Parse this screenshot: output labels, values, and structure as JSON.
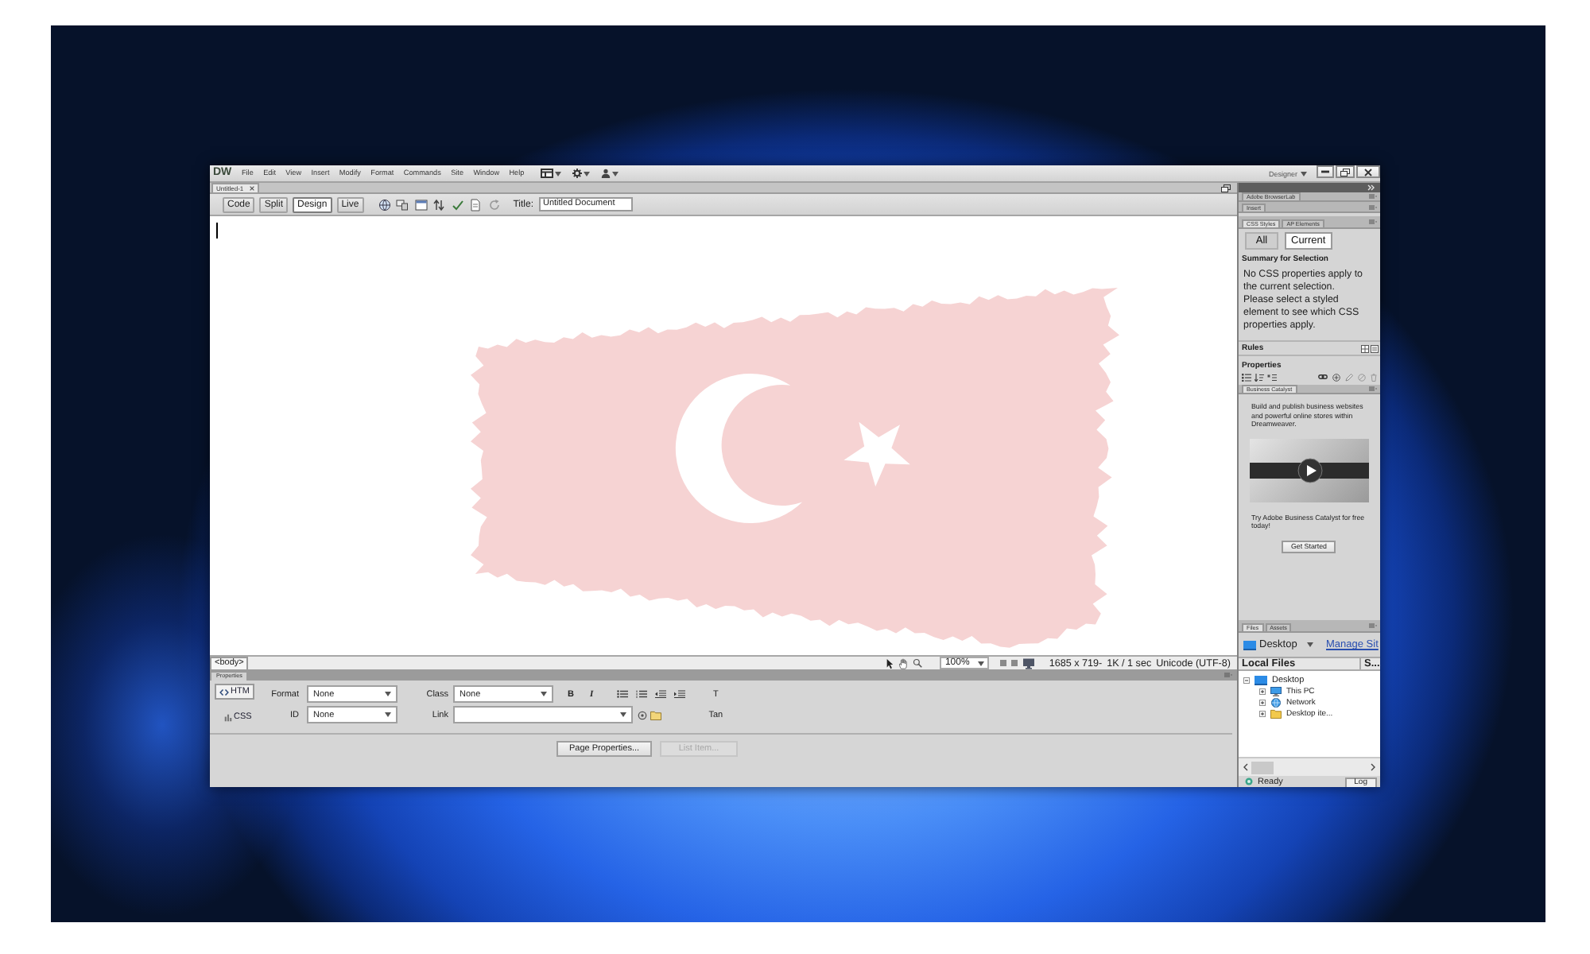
{
  "menu_bar": {
    "logo": "DW",
    "items": [
      "File",
      "Edit",
      "View",
      "Insert",
      "Modify",
      "Format",
      "Commands",
      "Site",
      "Window",
      "Help"
    ],
    "workspace": "Designer"
  },
  "document_tabs": [
    {
      "label": "Untitled-1",
      "selected": true
    }
  ],
  "toolbar": {
    "views": [
      {
        "label": "Code",
        "selected": false
      },
      {
        "label": "Split",
        "selected": false
      },
      {
        "label": "Design",
        "selected": true
      },
      {
        "label": "Live",
        "selected": false
      }
    ],
    "title_label": "Title:",
    "title_value": "Untitled Document"
  },
  "status_bar": {
    "tag": "<body>",
    "zoom": "100%",
    "size": "1685 x 719-",
    "download": "1K / 1 sec",
    "encoding": "Unicode (UTF-8)"
  },
  "properties": {
    "tab": "Properties",
    "modes": [
      {
        "label": "HTM",
        "kind": "html",
        "selected": true
      },
      {
        "label": "CSS",
        "kind": "css",
        "selected": false
      }
    ],
    "fields": [
      {
        "label": "Format",
        "value": "None"
      },
      {
        "label": "ID",
        "value": "None"
      }
    ],
    "class_field": {
      "label": "Class",
      "value": "None"
    },
    "link_field": {
      "label": "Link"
    },
    "bold": "B",
    "italic": "I",
    "title_label": "T",
    "target_label": "Tan",
    "buttons": [
      {
        "label": "Page Properties...",
        "disabled": false
      },
      {
        "label": "List Item...",
        "disabled": true
      }
    ]
  },
  "side_panels": {
    "collapsed": [
      "Adobe BrowserLab",
      "Insert"
    ],
    "css_tabs": [
      {
        "label": "CSS Styles",
        "selected": true
      },
      {
        "label": "AP Elements",
        "selected": false
      }
    ],
    "css_modes": [
      {
        "label": "All",
        "selected": false
      },
      {
        "label": "Current",
        "selected": true
      }
    ],
    "summary_heading": "Summary for Selection",
    "summary_text": "No CSS properties apply to the current selection. Please select a styled element to see which CSS properties apply.",
    "rules_heading": "Rules",
    "properties_heading": "Properties",
    "business_catalyst": {
      "tab": "Business Catalyst",
      "intro": "Build and publish business websites and powerful online stores within Dreamweaver.",
      "promo": "Try Adobe Business Catalyst for free today!",
      "button": "Get Started"
    },
    "files": {
      "tabs": [
        {
          "label": "Files",
          "selected": true
        },
        {
          "label": "Assets",
          "selected": false
        }
      ],
      "site": "Desktop",
      "manage_link": "Manage Sit",
      "columns": [
        "Local Files",
        "S..."
      ],
      "tree": [
        {
          "label": "Desktop",
          "kind": "desktop",
          "expanded": true,
          "children": [
            {
              "label": "This PC",
              "kind": "computer",
              "expanded": false
            },
            {
              "label": "Network",
              "kind": "network",
              "expanded": false
            },
            {
              "label": "Desktop ite...",
              "kind": "folder",
              "expanded": false
            }
          ]
        }
      ],
      "status": "Ready",
      "log_button": "Log"
    }
  }
}
